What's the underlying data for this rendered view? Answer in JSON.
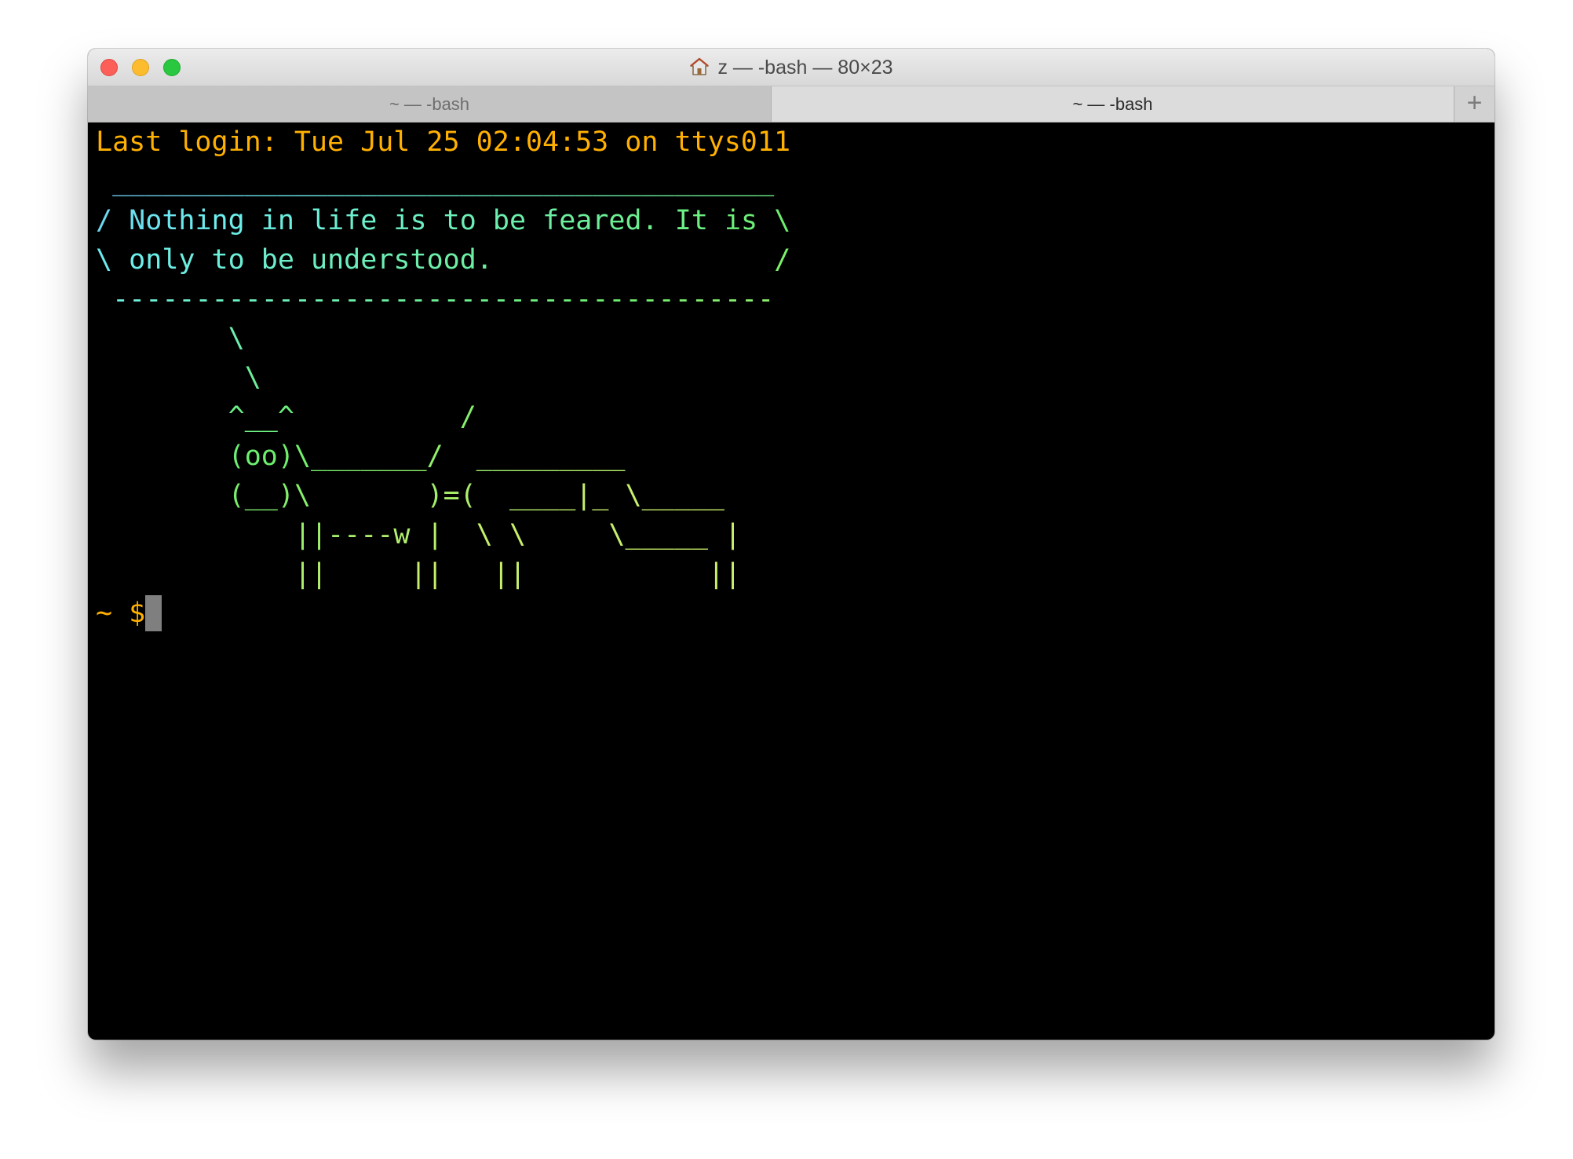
{
  "window": {
    "title": "z — -bash — 80×23",
    "traffic_lights": {
      "close_color": "#fc5f57",
      "minimize_color": "#fdbc2e",
      "zoom_color": "#29c840"
    },
    "title_icon": "home-icon"
  },
  "tabs": [
    {
      "label": "~ — -bash",
      "active": false
    },
    {
      "label": "~ — -bash",
      "active": true
    }
  ],
  "new_tab_label": "+",
  "terminal": {
    "background": "#000000",
    "last_login": "Last login: Tue Jul 25 02:04:53 on ttys011",
    "cowsay_lines": [
      " ________________________________________",
      "/ Nothing in life is to be feared. It is \\",
      "\\ only to be understood.                 /",
      " ----------------------------------------",
      "        \\",
      "         \\",
      "        ^__^          /",
      "        (oo)\\_______/  _________",
      "        (__)\\       )=(  ____|_ \\_____",
      "            ||----w |  \\ \\     \\_____ |",
      "            ||     ||   ||           ||"
    ],
    "prompt": "~ $"
  }
}
